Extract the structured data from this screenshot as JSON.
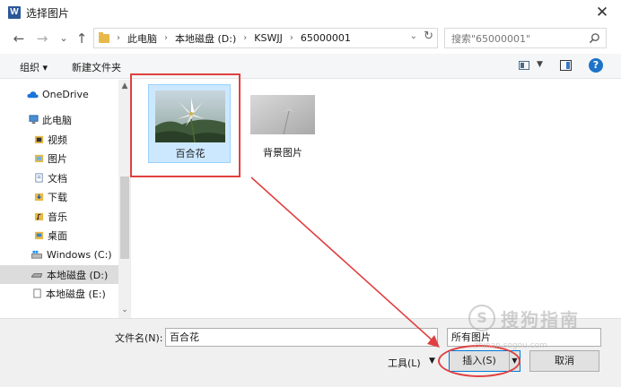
{
  "window": {
    "app_icon_letter": "W",
    "title": "选择图片",
    "close_glyph": "✕"
  },
  "nav": {
    "back": "←",
    "forward": "→",
    "recent": "⌄",
    "up": "↑",
    "breadcrumbs": [
      "此电脑",
      "本地磁盘 (D:)",
      "KSWJJ",
      "65000001"
    ],
    "breadcrumb_sep": "›",
    "search_placeholder": "搜索\"65000001\""
  },
  "toolbar": {
    "organize": "组织 ▾",
    "new_folder": "新建文件夹",
    "help": "?"
  },
  "sidebar": {
    "items": [
      {
        "label": "OneDrive",
        "icon": "cloud-icon"
      },
      {
        "label": "此电脑",
        "icon": "computer-icon"
      },
      {
        "label": "视频",
        "icon": "video-folder-icon"
      },
      {
        "label": "图片",
        "icon": "picture-folder-icon"
      },
      {
        "label": "文档",
        "icon": "document-folder-icon"
      },
      {
        "label": "下载",
        "icon": "download-folder-icon"
      },
      {
        "label": "音乐",
        "icon": "music-folder-icon"
      },
      {
        "label": "桌面",
        "icon": "desktop-folder-icon"
      },
      {
        "label": "Windows (C:)",
        "icon": "windows-drive-icon"
      },
      {
        "label": "本地磁盘 (D:)",
        "icon": "drive-icon"
      },
      {
        "label": "本地磁盘 (E:)",
        "icon": "drive-icon"
      }
    ]
  },
  "files": [
    {
      "name": "百合花",
      "selected": true
    },
    {
      "name": "背景图片",
      "selected": false
    }
  ],
  "bottom": {
    "filename_label": "文件名(N):",
    "filename_value": "百合花",
    "filter_value": "所有图片",
    "tools_label": "工具(L)",
    "insert_label": "插入(S)",
    "cancel_label": "取消"
  },
  "watermark": {
    "logo_letter": "S",
    "text": "搜狗指南",
    "url": "zhinan.sogou.com"
  },
  "colors": {
    "accent": "#0078d7",
    "selection": "#cce8ff",
    "annotation_red": "#e04040"
  }
}
